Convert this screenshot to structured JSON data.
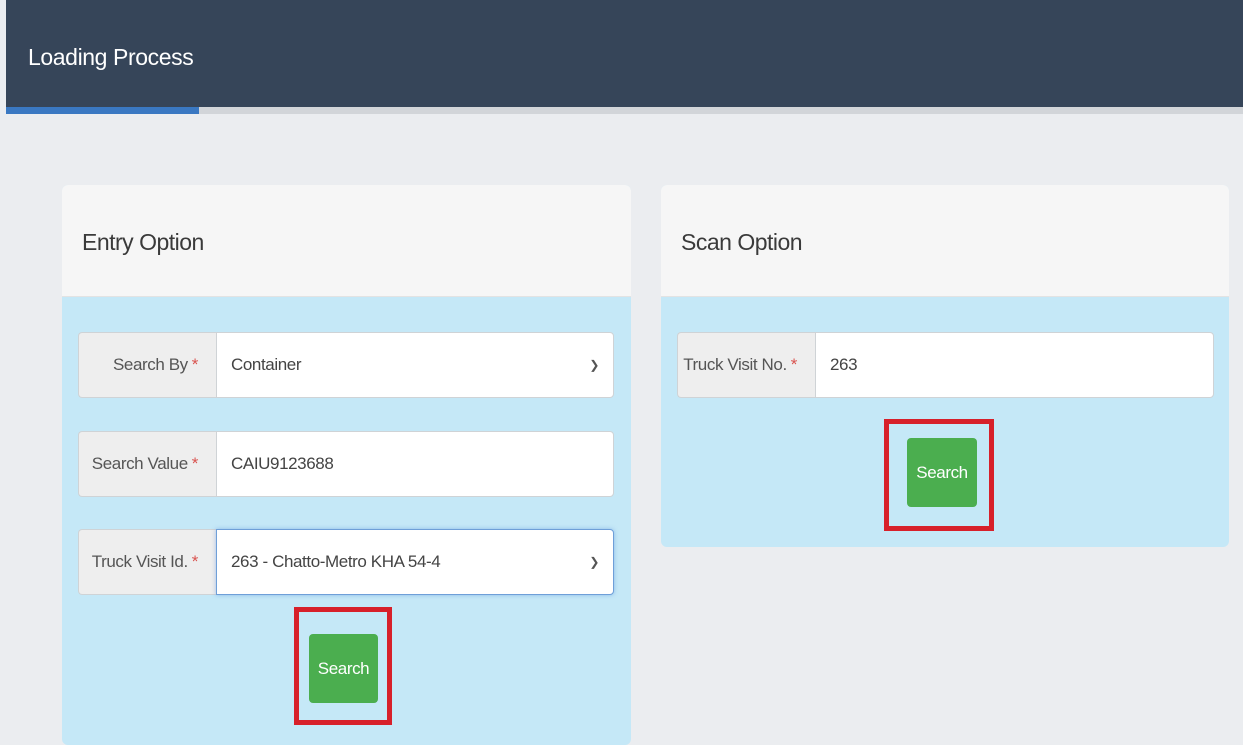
{
  "header": {
    "title": "Loading Process"
  },
  "entry": {
    "title": "Entry Option",
    "search_by": {
      "label": "Search By",
      "required": "*",
      "value": "Container"
    },
    "search_value": {
      "label": "Search Value",
      "required": "*",
      "value": "CAIU9123688"
    },
    "truck_visit_id": {
      "label": "Truck Visit Id.",
      "required": "*",
      "value": "263 - Chatto-Metro KHA 54-4"
    },
    "search_button": "Search"
  },
  "scan": {
    "title": "Scan Option",
    "truck_visit_no": {
      "label": "Truck Visit No.",
      "required": "*",
      "value": "263"
    },
    "search_button": "Search"
  },
  "colors": {
    "header": "#364559",
    "accent": "#3a78c2",
    "panel_body": "#c5e8f7",
    "button": "#4bae4f",
    "highlight": "#d7202a",
    "required": "#d9534f"
  },
  "icons": {
    "select_arrow": "chevron-down-icon"
  }
}
